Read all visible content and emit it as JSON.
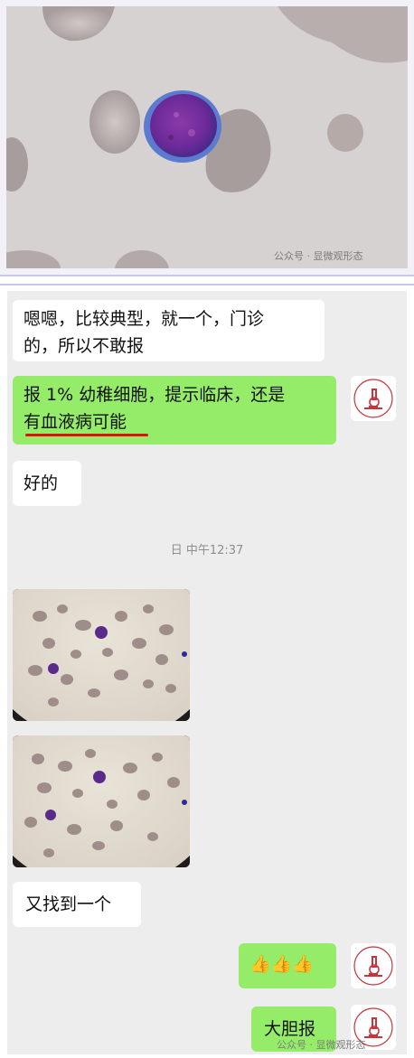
{
  "top_image": {
    "watermark": "公众号 · 显微观形态"
  },
  "chat": {
    "messages": [
      {
        "side": "left",
        "text_line1": "嗯嗯，比较典型，就一个，门诊",
        "text_line2": "的，所以不敢报"
      },
      {
        "side": "right",
        "text_line1": "报 1% 幼稚细胞，提示临床，还是",
        "text_line2": "有血液病可能"
      },
      {
        "side": "left",
        "text": "好的"
      },
      {
        "side": "left",
        "text": "又找到一个"
      },
      {
        "side": "right",
        "emoji": "👍👍👍"
      },
      {
        "side": "right",
        "text": "大胆报"
      }
    ],
    "timestamp": "日 中午12:37",
    "watermark": "公众号 · 显微观形态"
  },
  "colors": {
    "green_bubble": "#95ec69",
    "chat_background": "#ededed",
    "underline": "#e01010"
  }
}
